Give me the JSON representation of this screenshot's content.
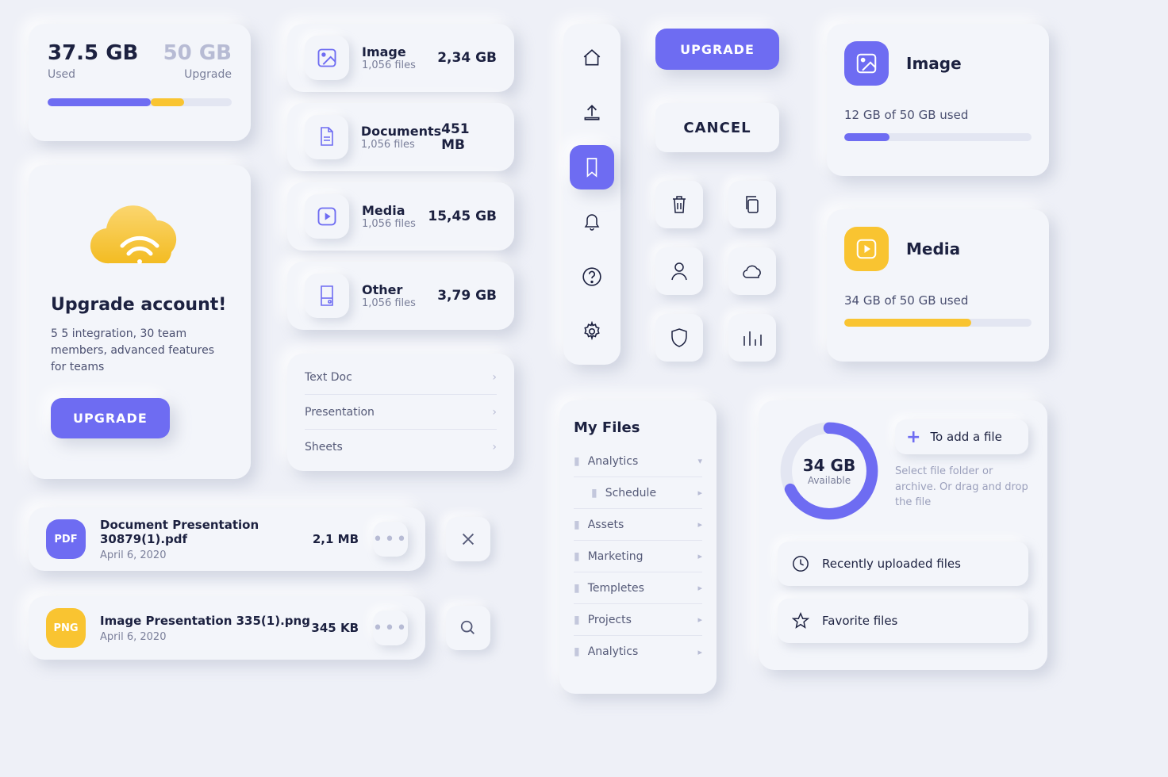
{
  "storage": {
    "used_value": "37.5 GB",
    "used_label": "Used",
    "total_value": "50 GB",
    "total_label": "Upgrade"
  },
  "upgrade_card": {
    "title": "Upgrade account!",
    "subtitle": "5 5 integration, 30 team members, advanced features for teams",
    "button": "UPGRADE"
  },
  "file_types": [
    {
      "name": "Image",
      "sub": "1,056 files",
      "size": "2,34 GB"
    },
    {
      "name": "Documents",
      "sub": "1,056 files",
      "size": "451 MB"
    },
    {
      "name": "Media",
      "sub": "1,056 files",
      "size": "15,45 GB"
    },
    {
      "name": "Other",
      "sub": "1,056 files",
      "size": "3,79 GB"
    }
  ],
  "doc_menu": [
    "Text Doc",
    "Presentation",
    "Sheets"
  ],
  "recent_files": [
    {
      "badge": "PDF",
      "name": "Document Presentation 30879(1).pdf",
      "size": "2,1 MB",
      "date": "April 6, 2020"
    },
    {
      "badge": "PNG",
      "name": "Image Presentation 335(1).png",
      "size": "345 KB",
      "date": "April 6, 2020"
    }
  ],
  "top_buttons": {
    "upgrade": "UPGRADE",
    "cancel": "CANCEL"
  },
  "my_files": {
    "title": "My Files",
    "items": [
      "Analytics",
      "Schedule",
      "Assets",
      "Marketing",
      "Templetes",
      "Projects",
      "Analytics"
    ]
  },
  "usage_cards": [
    {
      "title": "Image",
      "detail": "12 GB of 50 GB used"
    },
    {
      "title": "Media",
      "detail": "34 GB of 50 GB used"
    }
  ],
  "donut": {
    "value": "34 GB",
    "label": "Available"
  },
  "add_file": {
    "label": "To add a file",
    "hint": "Select file folder or archive. Or drag and drop the file"
  },
  "quick_links": [
    "Recently uploaded files",
    "Favorite files"
  ]
}
